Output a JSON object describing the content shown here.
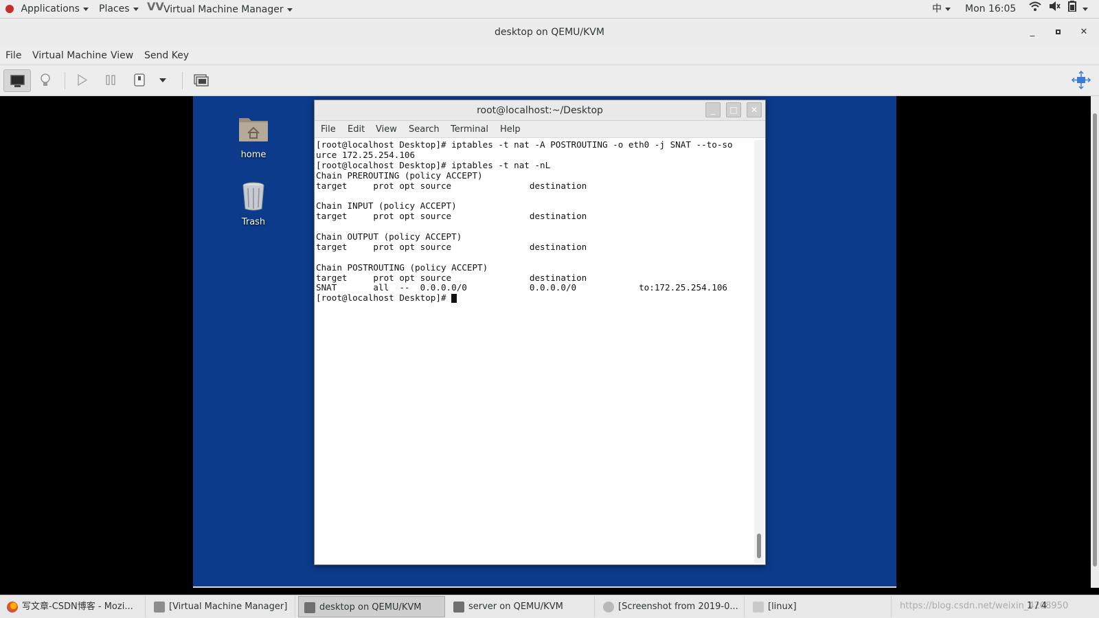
{
  "topbar": {
    "applications": "Applications",
    "places": "Places",
    "active_app": "Virtual Machine Manager",
    "input_method": "中",
    "clock": "Mon 16:05"
  },
  "window": {
    "title": "desktop on QEMU/KVM",
    "menu": [
      "File",
      "Virtual Machine",
      "View",
      "Send Key"
    ]
  },
  "guest": {
    "desktop_icons": [
      {
        "label": "home",
        "icon": "home-folder-icon"
      },
      {
        "label": "Trash",
        "icon": "trash-icon"
      }
    ],
    "terminal": {
      "title": "root@localhost:~/Desktop",
      "menu": [
        "File",
        "Edit",
        "View",
        "Search",
        "Terminal",
        "Help"
      ],
      "lines": [
        "[root@localhost Desktop]# iptables -t nat -A POSTROUTING -o eth0 -j SNAT --to-so",
        "urce 172.25.254.106",
        "[root@localhost Desktop]# iptables -t nat -nL",
        "Chain PREROUTING (policy ACCEPT)",
        "target     prot opt source               destination",
        "",
        "Chain INPUT (policy ACCEPT)",
        "target     prot opt source               destination",
        "",
        "Chain OUTPUT (policy ACCEPT)",
        "target     prot opt source               destination",
        "",
        "Chain POSTROUTING (policy ACCEPT)",
        "target     prot opt source               destination",
        "SNAT       all  --  0.0.0.0/0            0.0.0.0/0            to:172.25.254.106"
      ],
      "prompt": "[root@localhost Desktop]# "
    }
  },
  "taskbar": {
    "tasks": [
      {
        "label": "写文章-CSDN博客 - Mozi...",
        "icon": "firefox-icon",
        "active": false
      },
      {
        "label": "[Virtual Machine Manager]",
        "icon": "vmm-icon",
        "active": false
      },
      {
        "label": "desktop on QEMU/KVM",
        "icon": "vmm-icon",
        "active": true
      },
      {
        "label": "server on QEMU/KVM",
        "icon": "vmm-icon",
        "active": false
      },
      {
        "label": "[Screenshot from 2019-0...",
        "icon": "screenshot-icon",
        "active": false
      },
      {
        "label": "[linux]",
        "icon": "folder-icon",
        "active": false
      }
    ],
    "watermark": "https://blog.csdn.net/weixin_4208950",
    "pager": "1 / 4"
  },
  "colors": {
    "guest_desktop_bg": "#0c3b8c",
    "host_chrome": "#ededed",
    "terminal_bg": "#ffffff"
  }
}
